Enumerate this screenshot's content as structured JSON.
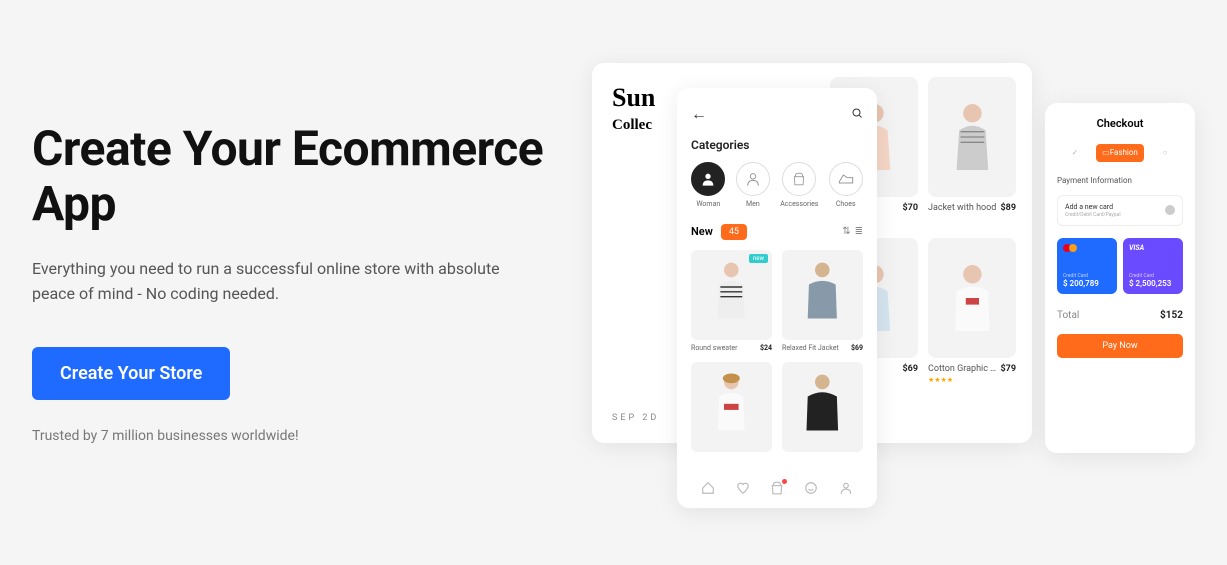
{
  "hero": {
    "title": "Create Your Ecommerce App",
    "subtitle": "Everything you need to run a successful online store with absolute peace of mind - No coding needed.",
    "cta": "Create Your Store",
    "trusted": "Trusted by 7 million businesses worldwide!"
  },
  "grid_panel": {
    "title": "Sun",
    "subtitle": "Collec",
    "date": "SEP  2D",
    "products": [
      {
        "name": "",
        "price": "$70"
      },
      {
        "name": "Jacket with hood",
        "price": "$89"
      },
      {
        "name": "",
        "price": "$69"
      },
      {
        "name": "Cotton Graphic Tee",
        "price": "$79",
        "stars": "★★★★"
      }
    ]
  },
  "app_panel": {
    "categories_label": "Categories",
    "categories": [
      {
        "name": "Woman",
        "active": true
      },
      {
        "name": "Men",
        "active": false
      },
      {
        "name": "Accessories",
        "active": false
      },
      {
        "name": "Choes",
        "active": false
      }
    ],
    "new_label": "New",
    "new_count": "45",
    "products": [
      {
        "name": "Round sweater",
        "price": "$24",
        "tag": "new"
      },
      {
        "name": "Relaxed Fit Jacket",
        "price": "$69"
      }
    ]
  },
  "checkout": {
    "title": "Checkout",
    "tab_active": "Fashion",
    "section": "Payment Information",
    "input_label": "Add a new card",
    "input_sub": "Credit/Debit Card/Paypal",
    "cards": [
      {
        "type": "mastercard",
        "label": "Credit Card",
        "amount": "$ 200,789"
      },
      {
        "type": "visa",
        "label": "Credit Card",
        "amount": "$ 2,500,253"
      }
    ],
    "total_label": "Total",
    "total_value": "$152",
    "pay_button": "Pay Now"
  }
}
